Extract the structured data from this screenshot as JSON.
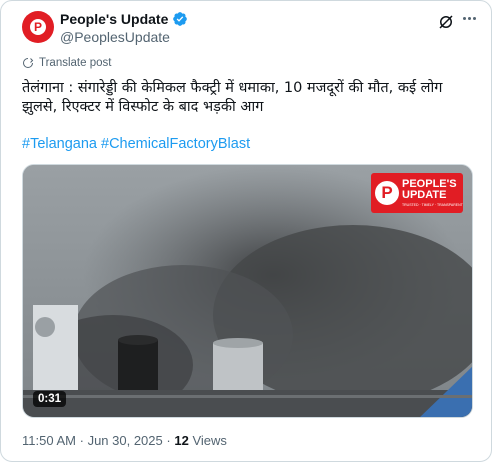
{
  "tweet": {
    "display_name": "People's Update",
    "handle": "@PeoplesUpdate",
    "translate_label": "Translate post",
    "text": "तेलंगाना : संगारेड्डी की केमिकल फैक्ट्री में धमाका, 10 मजदूरों की मौत, कई लोग झुलसे, रिएक्टर में विस्फोट के बाद भड़की आग",
    "hashtags": "#Telangana #ChemicalFactoryBlast",
    "media": {
      "duration": "0:31",
      "watermark_line1": "PEOPLE'S",
      "watermark_line2": "UPDATE",
      "watermark_sub": "TRUSTED · TIMELY · TRANSPARENT"
    },
    "time": "11:50 AM",
    "separator": "·",
    "date": "Jun 30, 2025",
    "views_count": "12",
    "views_label": "Views"
  },
  "colors": {
    "brand_red": "#e11d24",
    "link_blue": "#1d9bf0",
    "verified_blue": "#1d9bf0",
    "muted": "#536471"
  },
  "icons": {
    "verified": "verified-badge-icon",
    "grok": "grok-icon",
    "more": "more-options-icon",
    "translate": "translate-icon"
  }
}
